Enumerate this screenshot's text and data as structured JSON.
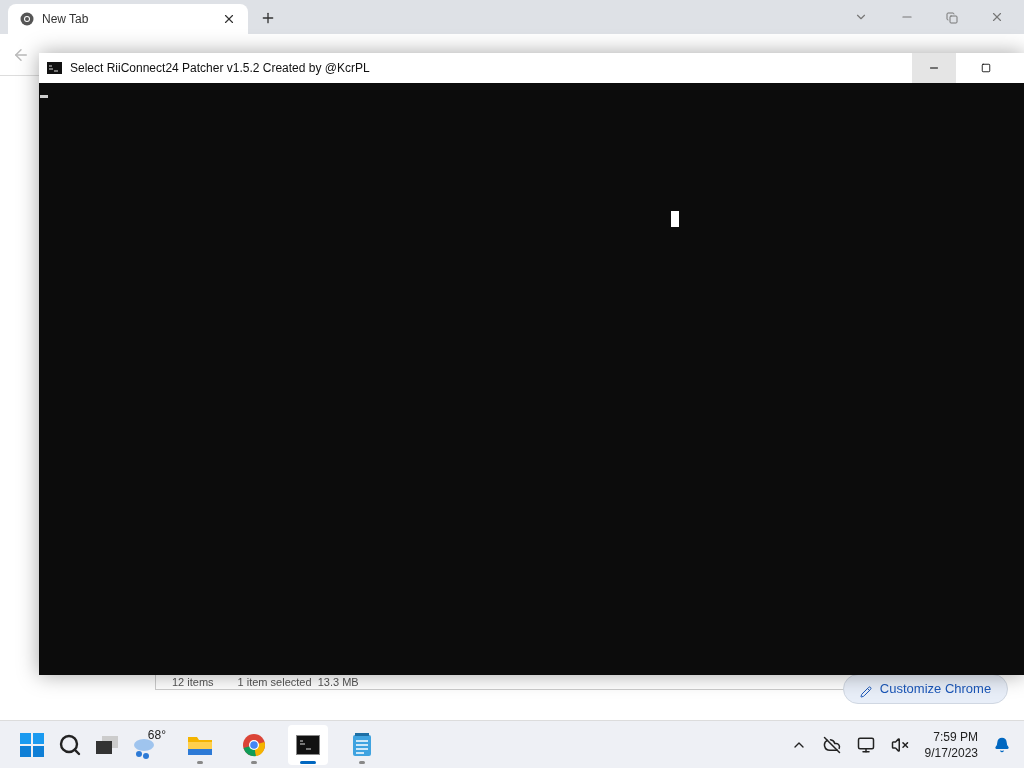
{
  "browser": {
    "tabs": [
      {
        "label": "New Tab",
        "selected": true
      }
    ]
  },
  "explorer_status": {
    "items_count": "12 items",
    "selection": "1 item selected  13.3 MB"
  },
  "customize_button": {
    "label": "Customize Chrome"
  },
  "console": {
    "title": "Select RiiConnect24 Patcher v1.5.2 Created by @KcrPL"
  },
  "taskbar": {
    "weather": "68°",
    "apps": [
      {
        "kind": "explorer",
        "selected": false,
        "running": true
      },
      {
        "kind": "chrome",
        "selected": false,
        "running": true
      },
      {
        "kind": "terminal",
        "selected": true,
        "running": true
      },
      {
        "kind": "notepad",
        "selected": false,
        "running": true
      }
    ],
    "time": "7:59 PM",
    "date": "9/17/2023"
  }
}
